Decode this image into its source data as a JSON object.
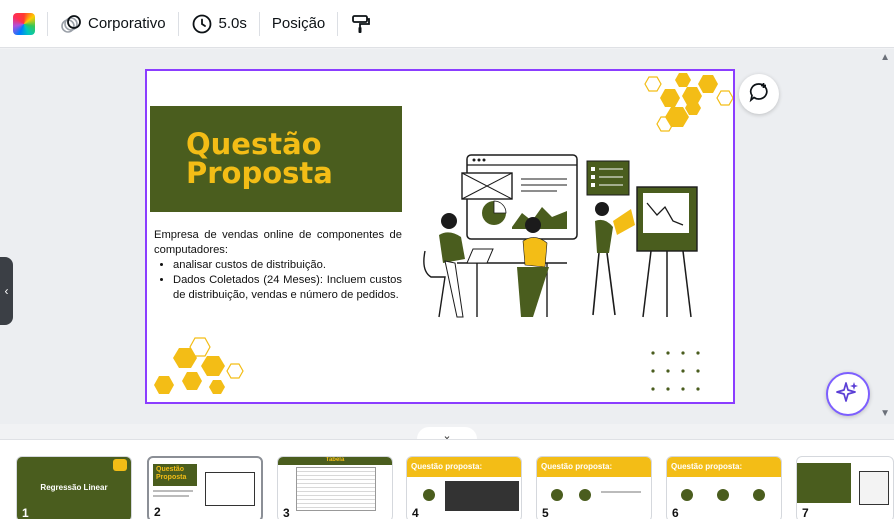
{
  "toolbar": {
    "color_icon": "color-palette-icon",
    "animation_label": "Corporativo",
    "duration_label": "5.0s",
    "position_label": "Posição",
    "format_icon": "paint-roller-icon"
  },
  "slide": {
    "title_line1": "Questão",
    "title_line2": "Proposta",
    "paragraph": "Empresa de vendas online de componentes de computadores:",
    "bullets": [
      "analisar custos de distribuição.",
      "Dados Coletados (24 Meses): Incluem custos de distribuição, vendas e número de pedidos."
    ],
    "colors": {
      "green": "#4a5d1e",
      "yellow": "#f3bd16",
      "selection": "#8b3dff"
    }
  },
  "filmstrip": {
    "thumbs": [
      {
        "number": "1",
        "title": "Regressão Linear"
      },
      {
        "number": "2",
        "title": "Questão Proposta"
      },
      {
        "number": "3",
        "title": "Tabela"
      },
      {
        "number": "4",
        "title": "Questão proposta:"
      },
      {
        "number": "5",
        "title": "Questão proposta:"
      },
      {
        "number": "6",
        "title": "Questão proposta:"
      },
      {
        "number": "7",
        "title": ""
      }
    ]
  }
}
